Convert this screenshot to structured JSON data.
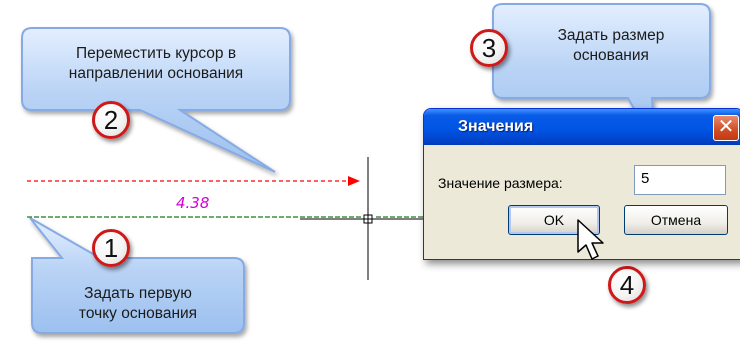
{
  "callouts": {
    "c2": {
      "line1": "Переместить курсор в",
      "line2": "направлении основания"
    },
    "c1": {
      "line1": "Задать первую",
      "line2": "точку основания"
    },
    "c3": {
      "line1": "Задать размер",
      "line2": "основания"
    }
  },
  "markers": {
    "m1": "1",
    "m2": "2",
    "m3": "3",
    "m4": "4"
  },
  "drawing": {
    "measure_label": "4.38"
  },
  "dialog": {
    "title": "Значения",
    "close_glyph": "✕",
    "field_label": "Значение размера:",
    "field_value": "5",
    "ok_label": "OK",
    "cancel_label": "Отмена"
  },
  "colors": {
    "callout_fill": "#b9d3f5",
    "callout_border": "#7ea6e3",
    "marker_border": "#d01818",
    "measure_color": "#d400d4",
    "arrow_line": "#ff0000",
    "base_line": "#1a7a1a",
    "titlebar": "#0055e5"
  },
  "icons": {
    "pointer": "mouse-pointer-icon",
    "close": "close-icon"
  }
}
